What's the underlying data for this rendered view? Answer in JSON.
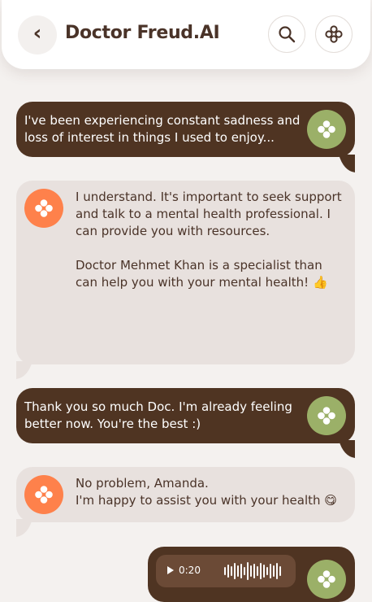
{
  "header": {
    "back_glyph": "‹",
    "title": "Doctor Freud.AI"
  },
  "messages": [
    {
      "from": "user",
      "text": "I've been experiencing constant sadness and loss of interest in things I used to enjoy..."
    },
    {
      "from": "bot",
      "text": "I understand. It's important to seek support and talk to a mental health professional. I can provide you with resources.\n\nDoctor Mehmet Khan is a specialist than can help you with your mental health! 👍"
    },
    {
      "from": "user",
      "text": "Thank you so much Doc. I'm already feeling better now. You're the best :)"
    },
    {
      "from": "bot",
      "text": "No problem, Amanda.\nI'm happy to assist you with your health 😋"
    }
  ],
  "audio": {
    "duration": "0:20"
  },
  "colors": {
    "user_bubble": "#4f3422",
    "bot_bubble": "#e8e1de",
    "green_avatar": "#9bb068",
    "orange_avatar": "#fe814b",
    "background": "#f4f1ef"
  },
  "icons": {
    "back": "chevron-left-icon",
    "search": "search-icon",
    "menu": "freud-logo-icon"
  }
}
